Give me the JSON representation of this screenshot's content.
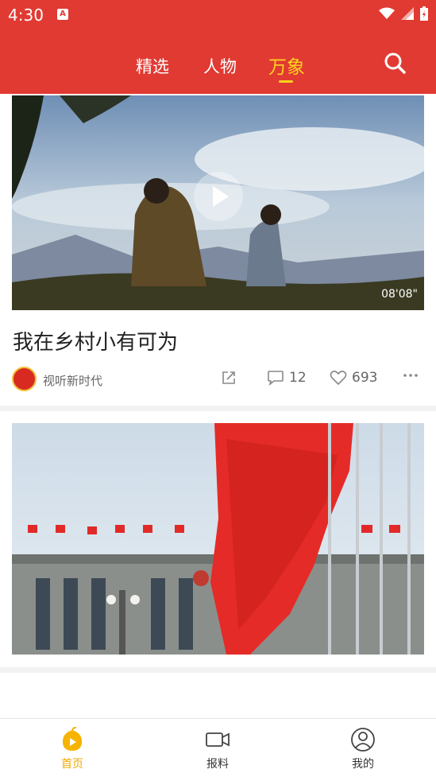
{
  "status": {
    "time": "4:30",
    "notification_badge": "A"
  },
  "tabs": [
    {
      "label": "精选"
    },
    {
      "label": "人物"
    },
    {
      "label": "万象",
      "active": true
    }
  ],
  "colors": {
    "brand": "#e03a32",
    "accent": "#ffd21f",
    "nav_active": "#f0a800"
  },
  "feed": {
    "video": {
      "duration": "08'08\"",
      "title": "我在乡村小有可为",
      "author": "视听新时代",
      "comments": "12",
      "likes": "693"
    }
  },
  "bottom_nav": [
    {
      "label": "首页",
      "icon": "home-play-icon",
      "active": true
    },
    {
      "label": "报料",
      "icon": "video-camera-icon"
    },
    {
      "label": "我的",
      "icon": "user-icon"
    }
  ]
}
